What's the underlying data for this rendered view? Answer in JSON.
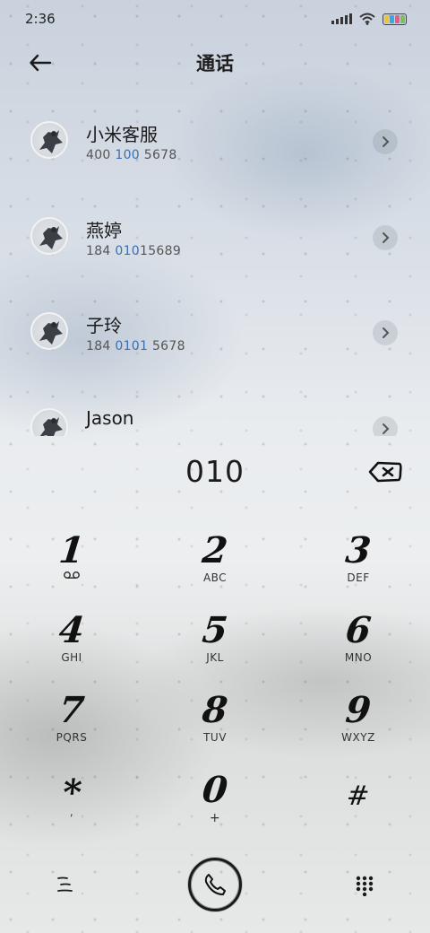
{
  "status_bar": {
    "time": "2:36",
    "battery_colors": [
      "#f2c230",
      "#3aa8e0",
      "#e65b8a",
      "#77c35a"
    ]
  },
  "header": {
    "title": "通话",
    "back_icon": "arrow-left-icon"
  },
  "contacts": [
    {
      "name": "小米客服",
      "number_pre": "400 ",
      "number_hl": "100",
      "number_post": " 5678"
    },
    {
      "name": "燕婷",
      "number_pre": "184 ",
      "number_hl": "010",
      "number_post": "15689"
    },
    {
      "name": "子玲",
      "number_pre": "184 ",
      "number_hl": "0101",
      "number_post": " 5678"
    },
    {
      "name": "Jason",
      "number_pre": "",
      "number_hl": "",
      "number_post": ""
    }
  ],
  "dialer": {
    "input": "010",
    "backspace_icon": "backspace-icon",
    "keys": [
      {
        "num": "1",
        "sub": "ꝏ"
      },
      {
        "num": "2",
        "sub": "ABC"
      },
      {
        "num": "3",
        "sub": "DEF"
      },
      {
        "num": "4",
        "sub": "GHI"
      },
      {
        "num": "5",
        "sub": "JKL"
      },
      {
        "num": "6",
        "sub": "MNO"
      },
      {
        "num": "7",
        "sub": "PQRS"
      },
      {
        "num": "8",
        "sub": "TUV"
      },
      {
        "num": "9",
        "sub": "WXYZ"
      },
      {
        "num": "*",
        "sub": ","
      },
      {
        "num": "0",
        "sub": "+"
      },
      {
        "num": "#",
        "sub": ""
      }
    ]
  },
  "bottom_bar": {
    "menu_icon": "menu-icon",
    "call_icon": "phone-icon",
    "keypad_icon": "keypad-icon"
  }
}
